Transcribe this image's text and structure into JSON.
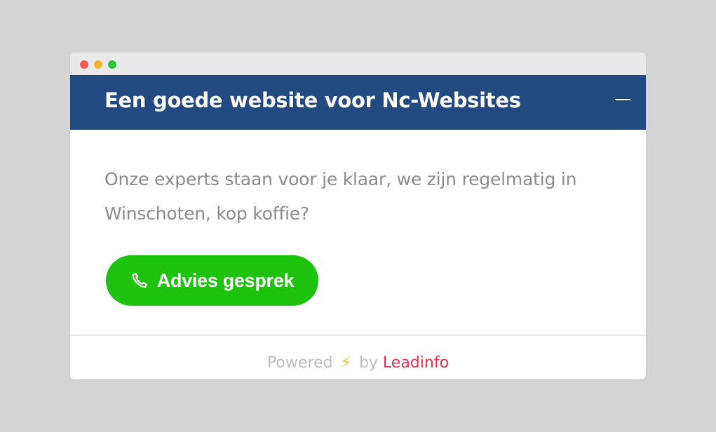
{
  "widget": {
    "title": "Een goede website voor Nc-Websites",
    "message": "Onze experts staan voor je klaar, we zijn regelmatig in Winschoten, kop koffie?",
    "cta_label": "Advies gesprek",
    "icons": {
      "minimize": "minus-icon",
      "cta": "phone-icon",
      "footer": "lightning-bolt-icon"
    }
  },
  "footer": {
    "powered": "Powered",
    "bolt": "⚡",
    "by": "by",
    "brand": "Leadinfo"
  },
  "colors": {
    "header_bg": "#234a80",
    "cta_bg": "#1ec30f",
    "brand": "#e5304a",
    "bolt": "#f7c126",
    "message_text": "#8b8b8b"
  }
}
